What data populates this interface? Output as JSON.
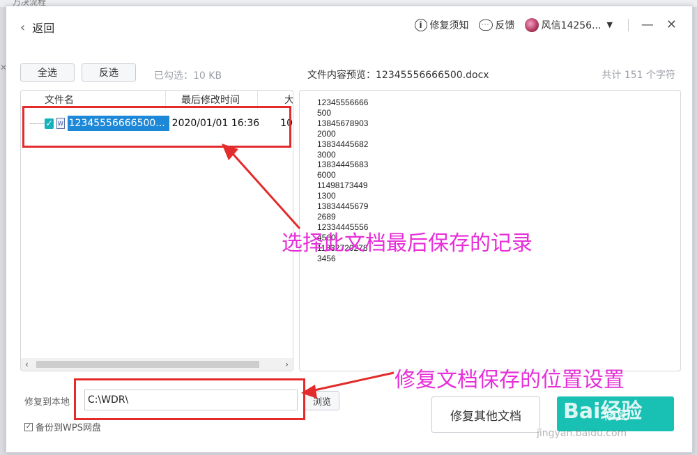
{
  "background": {
    "title_text": "万决流程"
  },
  "header": {
    "back_label": "返回",
    "repair_notes": "修复须知",
    "feedback": "反馈",
    "user_name": "风信14256...",
    "minimize": "—",
    "close": "✕"
  },
  "toolbar": {
    "select_all": "全选",
    "invert": "反选",
    "checked_info": "已勾选：10 KB",
    "preview_title": "文件内容预览：12345556666500.docx",
    "char_count": "共计 151 个字符"
  },
  "file_list": {
    "columns": [
      "文件名",
      "最后修改时间",
      "大"
    ],
    "rows": [
      {
        "name": "12345556666500...",
        "modified": "2020/01/01 16:36",
        "size": "10",
        "checked": true
      }
    ]
  },
  "preview": {
    "lines": [
      "12345556666",
      "500",
      "13845678903",
      "2000",
      "13834445682",
      "3000",
      "13834445683",
      "6000",
      "11498173449",
      "1300",
      "13834445679",
      "2689",
      "12334445556",
      "4560",
      "11832720278",
      "3456"
    ]
  },
  "footer": {
    "path_label": "修复到本地",
    "path_value": "C:\\WDR\\",
    "browse": "浏览",
    "backup_label": "备份到WPS网盘",
    "repair_other": "修复其他文档",
    "repair_button": "修复"
  },
  "annotations": {
    "select_record": "选择此文档最后保存的记录",
    "save_location": "修复文档保存的位置设置",
    "color_box": "#e32b2b",
    "color_text": "#e72ed8"
  },
  "watermark": {
    "logo": "Bai经验",
    "url": "jingyan.baidu.com"
  },
  "colors": {
    "accent": "#18c1b3",
    "selection": "#1e88d8",
    "checkbox": "#15b2b9"
  }
}
